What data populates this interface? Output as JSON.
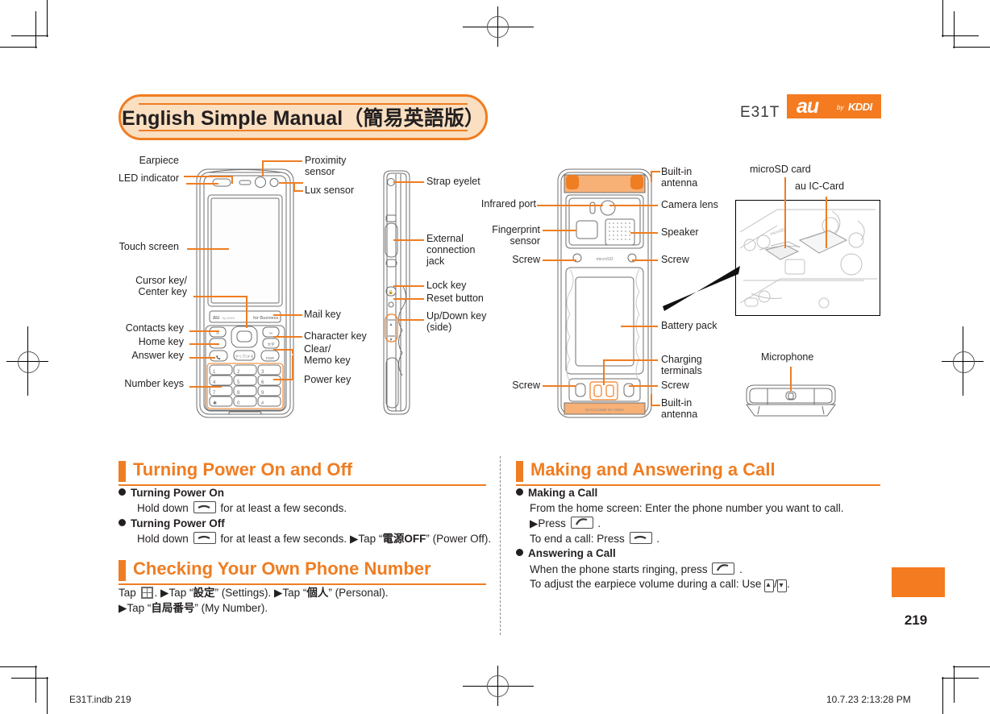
{
  "header": {
    "title": "English Simple Manual（簡易英語版）",
    "model": "E31T",
    "logo": {
      "au": "au",
      "by": "by",
      "kddi": "KDDI"
    }
  },
  "diagram_front": {
    "labels_left": [
      {
        "text": "Earpiece"
      },
      {
        "text": "LED indicator"
      },
      {
        "text": "Touch screen"
      },
      {
        "text": "Cursor key/\nCenter key"
      },
      {
        "text": "Contacts key"
      },
      {
        "text": "Home key"
      },
      {
        "text": "Answer key"
      },
      {
        "text": "Number keys"
      }
    ],
    "labels_right": [
      {
        "text": "Proximity\nsensor"
      },
      {
        "text": "Lux sensor"
      },
      {
        "text": "Mail key"
      },
      {
        "text": "Character key"
      },
      {
        "text": "Clear/\nMemo key"
      },
      {
        "text": "Power key"
      }
    ],
    "brand_au": "au",
    "brand_for_business": "for Business"
  },
  "diagram_side": {
    "labels_right": [
      {
        "text": "Strap eyelet"
      },
      {
        "text": "External\nconnection\njack"
      },
      {
        "text": "Lock key"
      },
      {
        "text": "Reset button"
      },
      {
        "text": "Up/Down key\n(side)"
      }
    ]
  },
  "diagram_back": {
    "labels_left": [
      {
        "text": "Infrared port"
      },
      {
        "text": "Fingerprint\nsensor"
      },
      {
        "text": "Screw"
      },
      {
        "text": "Screw"
      }
    ],
    "labels_right": [
      {
        "text": "Built-in\nantenna"
      },
      {
        "text": "Camera lens"
      },
      {
        "text": "Speaker"
      },
      {
        "text": "Screw"
      },
      {
        "text": "Battery pack"
      },
      {
        "text": "Charging\nterminals"
      },
      {
        "text": "Screw"
      },
      {
        "text": "Built-in\nantenna"
      }
    ],
    "microsd_mark": "microSD",
    "chipset_mark": "QUALCOMM 3G CDMA"
  },
  "diagram_detail": {
    "labels": [
      {
        "text": "microSD card"
      },
      {
        "text": "au IC-Card"
      },
      {
        "text": "Microphone"
      }
    ]
  },
  "sections": [
    {
      "id": "turning-power",
      "heading": "Turning Power On and Off",
      "items": [
        {
          "bullet": "Turning Power On",
          "lines": [
            "Hold down ⟦pwr⟧ for at least a few seconds."
          ]
        },
        {
          "bullet": "Turning Power Off",
          "lines": [
            "Hold down ⟦pwr⟧ for at least a few seconds. ▶Tap “電源OFF” (Power Off)."
          ]
        }
      ],
      "pre_key": "Hold down",
      "post_key_on": "for at least a few seconds.",
      "post_key_off": "for at least a few seconds.",
      "tap_off": "▶Tap “",
      "tap_off_jp": "電源OFF",
      "tap_off_en": "” (Power Off)."
    },
    {
      "id": "own-number",
      "heading": "Checking Your Own Phone Number",
      "line1_a": "Tap",
      "line1_b": ". ▶Tap “",
      "line1_jp1": "設定",
      "line1_c": "” (Settings). ▶Tap “",
      "line1_jp2": "個人",
      "line1_d": "” (Personal).",
      "line2_a": "▶Tap “",
      "line2_jp": "自局番号",
      "line2_b": "” (My Number)."
    },
    {
      "id": "making-answering",
      "heading": "Making and Answering a Call",
      "bullet1": "Making a Call",
      "m_line1": "From the home screen: Enter the phone number you want to call.",
      "m_line2_a": "▶Press",
      "m_line2_b": ".",
      "m_line3_a": "To end a call: Press",
      "m_line3_b": ".",
      "bullet2": "Answering a Call",
      "a_line1_a": "When the phone starts ringing, press",
      "a_line1_b": ".",
      "a_line2_a": "To adjust the earpiece volume during a call: Use",
      "a_line2_b": "/",
      "a_line2_c": "."
    }
  ],
  "footer": {
    "page_number": "219",
    "file_label": "E31T.indb   219",
    "timestamp": "10.7.23   2:13:28 PM"
  },
  "colors": {
    "accent": "#ef7d22",
    "accent_fill": "#fbdfc1",
    "logo_orange": "#f47b20",
    "ink": "#231f20",
    "line_gray": "#8a8a8a"
  }
}
